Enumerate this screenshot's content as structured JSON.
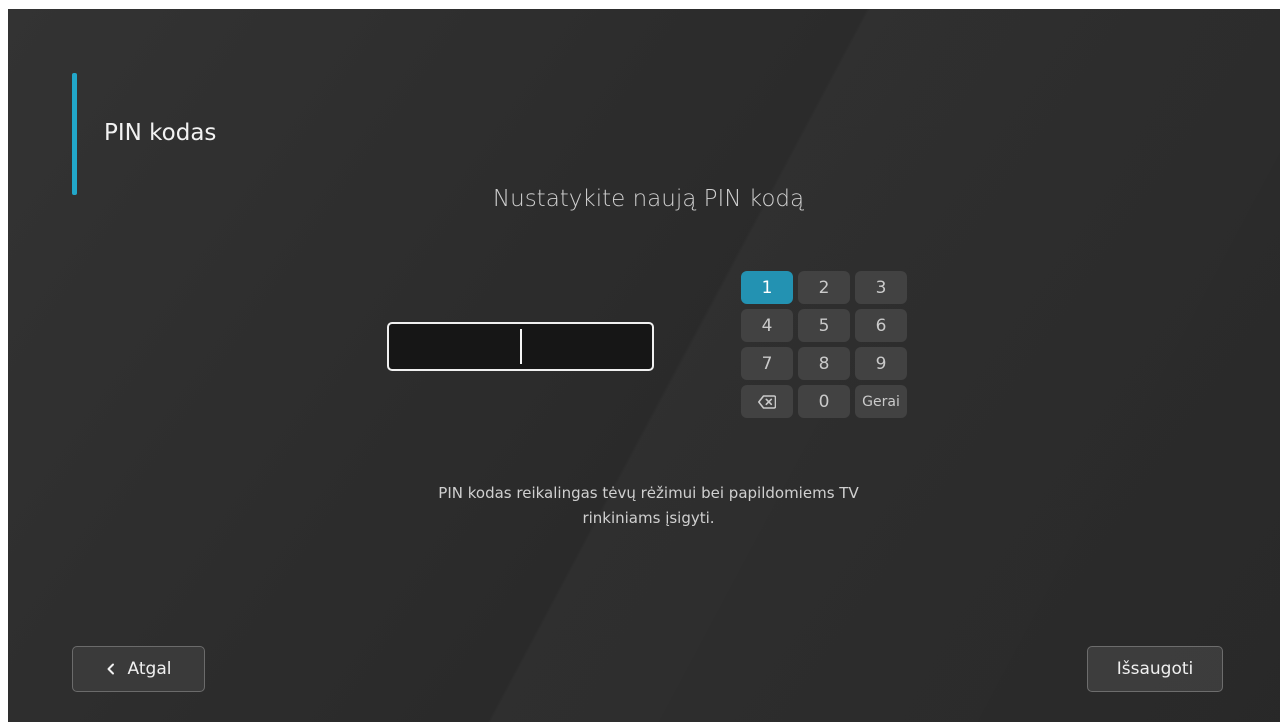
{
  "header": {
    "title": "PIN kodas"
  },
  "main": {
    "subtitle": "Nustatykite naują PIN kodą",
    "pin_value": "",
    "info_line1": "PIN kodas reikalingas tėvų rėžimui bei papildomiems TV",
    "info_line2": "rinkiniams įsigyti."
  },
  "keypad": {
    "keys": [
      "1",
      "2",
      "3",
      "4",
      "5",
      "6",
      "7",
      "8",
      "9"
    ],
    "backspace_icon": "backspace-icon",
    "zero": "0",
    "ok": "Gerai",
    "active_key": "1"
  },
  "footer": {
    "back_label": "Atgal",
    "back_icon": "chevron-left-icon",
    "save_label": "Išsaugoti"
  },
  "colors": {
    "accent": "#22a7c9",
    "active_key": "#1e8fb0",
    "background": "#2d2d2d"
  }
}
